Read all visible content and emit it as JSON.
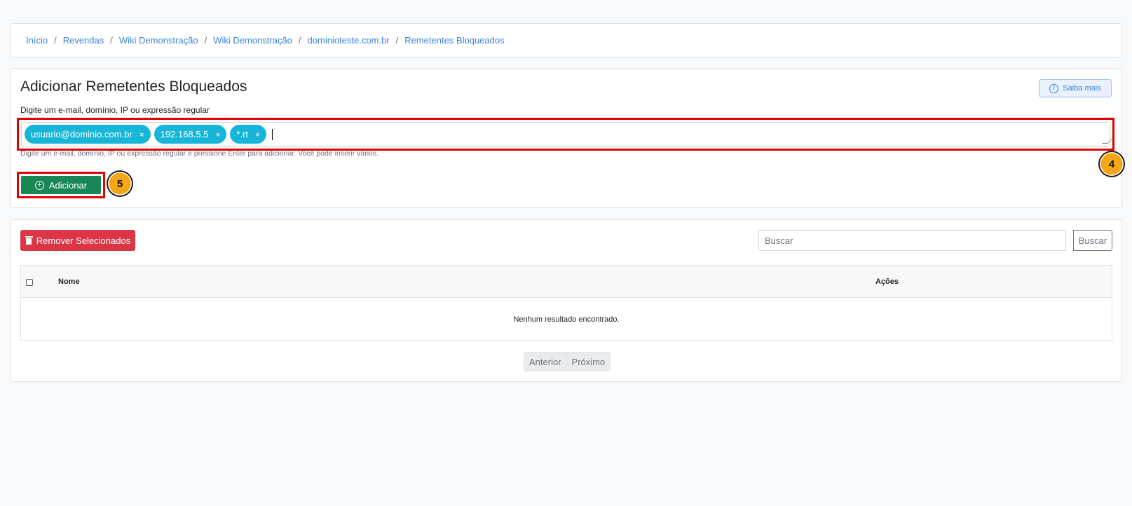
{
  "breadcrumb": {
    "items": [
      "Início",
      "Revendas",
      "Wiki Demonstração",
      "Wiki Demonstração",
      "dominioteste.com.br",
      "Remetentes Bloqueados"
    ],
    "separator": "/"
  },
  "add_section": {
    "title": "Adicionar Remetentes Bloqueados",
    "subtitle": "Digite um e-mail, domínio, IP ou expressão regular",
    "saiba_mais_label": "Saiba mais",
    "tags": [
      {
        "label": "usuario@dominio.com.br",
        "remove": "×"
      },
      {
        "label": "192.168.5.5",
        "remove": "×"
      },
      {
        "label": "*.rt",
        "remove": "×"
      }
    ],
    "help_text": "Digite um e-mail, domínio, IP ou expressão regular e pressione Enter para adicionar. Você pode inserir vários.",
    "add_button_label": "Adicionar",
    "step_badges": [
      "4",
      "5"
    ]
  },
  "list_section": {
    "remove_selected_label": "Remover Selecionados",
    "search": {
      "placeholder": "Buscar",
      "button_label": "Buscar"
    },
    "table": {
      "columns": [
        "Nome",
        "Ações"
      ],
      "empty_message": "Nenhum resultado encontrado."
    },
    "pagination": {
      "prev_label": "Anterior",
      "next_label": "Próximo"
    }
  },
  "colors": {
    "link": "#3b82d8",
    "tag": "#17b6d9",
    "add_button": "#198754",
    "remove_button": "#dc3545",
    "highlight": "#e00000",
    "badge": "#f5a614"
  }
}
